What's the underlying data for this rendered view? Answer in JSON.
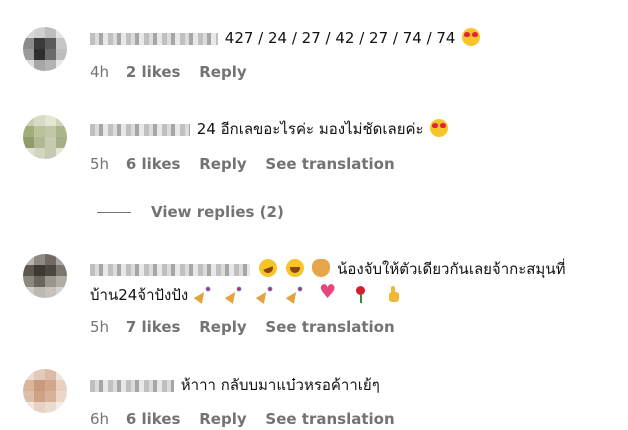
{
  "comments": [
    {
      "text": "427 / 24 / 27 / 42 / 27 / 74 / 74",
      "emojis_after": [
        "smiling-face-with-heart-eyes"
      ],
      "time": "4h",
      "likes": "2 likes",
      "reply": "Reply",
      "avatar_colors": [
        "#d9d9d9",
        "#cfcfcf",
        "#bdbdbd",
        "#e2e2e2",
        "#8a8a8a",
        "#3a3a3a",
        "#5a5a5a",
        "#c6c6c6",
        "#9a9a9a",
        "#2e2e2e",
        "#6b6b6b",
        "#bcbcbc",
        "#dcdcdc",
        "#a6a6a6",
        "#b3b3b3",
        "#e8e8e8"
      ]
    },
    {
      "text": "24 อีกเลขอะไรค่ะ มองไม่ชัดเลยค่ะ",
      "emojis_after": [
        "smiling-face-with-heart-eyes"
      ],
      "time": "5h",
      "likes": "6 likes",
      "reply": "Reply",
      "translate": "See translation",
      "avatar_colors": [
        "#c9cfb0",
        "#d8dcc4",
        "#e4e6d5",
        "#cfd3bb",
        "#9fae7a",
        "#b9c39a",
        "#c2c8a7",
        "#aab68a",
        "#8e9b6b",
        "#b0b894",
        "#c7cbb0",
        "#a4ae88",
        "#dfe1d1",
        "#d2d5c1",
        "#c6cab3",
        "#e3e5d7"
      ]
    },
    {
      "text_prefix_emojis": [
        "rolling-on-floor-laughing",
        "grinning-squinting-face",
        "cat-face"
      ],
      "text_line1": "น้องจับให้ตัวเดียวกันเลยจ้ากะสมุนที่",
      "text_line2": "บ้าน24จ้าปังปัง",
      "emojis_after": [
        "party-popper",
        "party-popper",
        "party-popper",
        "party-popper",
        "growing-heart",
        "rose",
        "thumbs-up"
      ],
      "time": "5h",
      "likes": "7 likes",
      "reply": "Reply",
      "translate": "See translation",
      "avatar_colors": [
        "#b8b4ad",
        "#8d8a83",
        "#6f6b64",
        "#a9a59e",
        "#5b5750",
        "#3e3a33",
        "#4c4841",
        "#7b776f",
        "#8c877f",
        "#6a665e",
        "#9a958d",
        "#b1ada5",
        "#cfcac3",
        "#bdb8b0",
        "#c6c1b9",
        "#d6d2cb"
      ]
    },
    {
      "text": "ห้าาา กลับบมาแบ๋วหรอค้าาเย้ๆ",
      "time": "6h",
      "likes": "6 likes",
      "reply": "Reply",
      "translate": "See translation",
      "avatar_colors": [
        "#eadcd2",
        "#e3c9b8",
        "#dcbba6",
        "#efe3da",
        "#d9b59c",
        "#c99a7d",
        "#d2a88c",
        "#e6d0c1",
        "#ddbfa9",
        "#cfa286",
        "#d8b197",
        "#ead7ca",
        "#f1e6de",
        "#e7d3c5",
        "#ecdcd0",
        "#f4ece6"
      ]
    }
  ],
  "view_replies": "View replies (2)"
}
